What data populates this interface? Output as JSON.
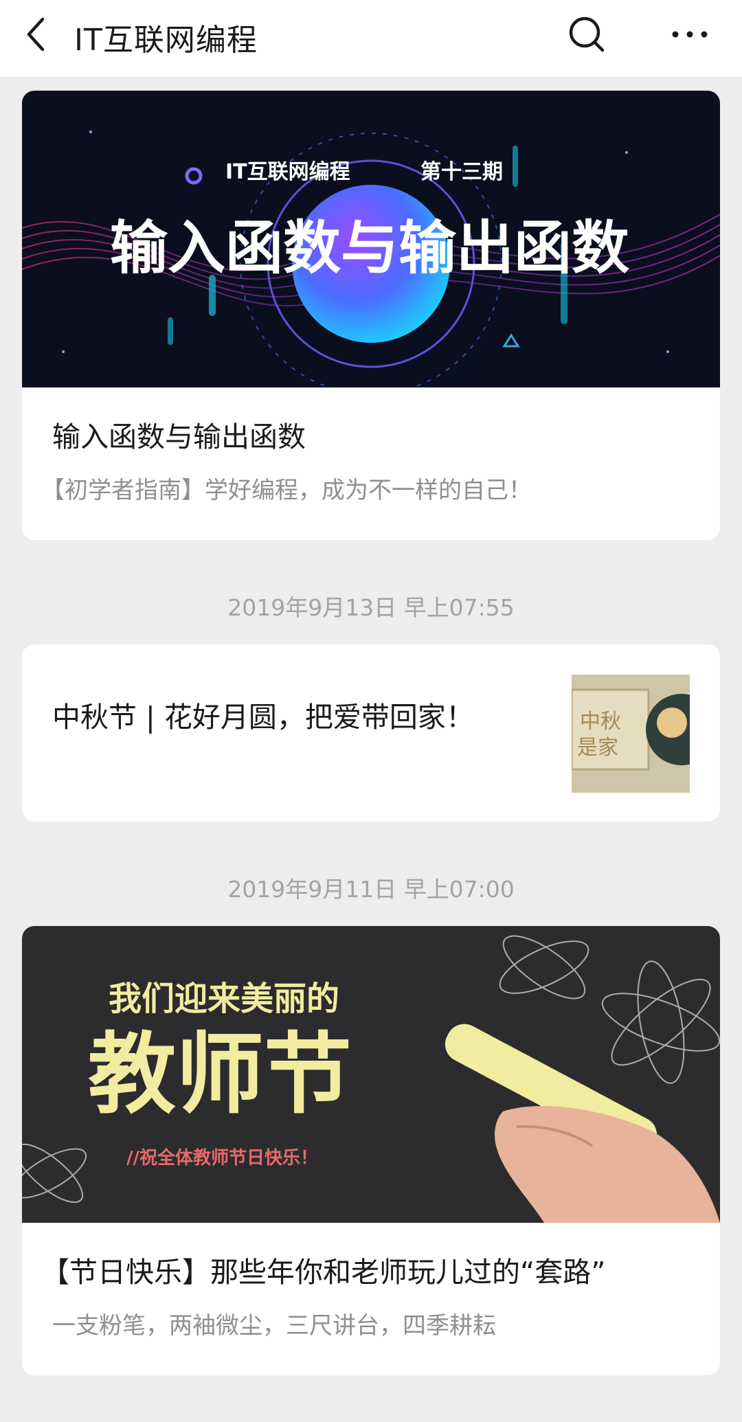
{
  "header": {
    "title": "IT互联网编程",
    "back_icon": "chevron-left-icon",
    "search_icon": "search-icon",
    "more_icon": "more-horizontal-icon"
  },
  "articles": [
    {
      "cover_line1_left": "IT互联网编程",
      "cover_line1_right": "第十三期",
      "cover_headline": "输入函数与输出函数",
      "title": "输入函数与输出函数",
      "digest": "【初学者指南】学好编程，成为不一样的自己！"
    },
    {
      "timestamp": "2019年9月13日 早上07:55",
      "title": "中秋节 | 花好月圆，把爱带回家！",
      "thumb_text_1": "中秋",
      "thumb_text_2": "是家"
    },
    {
      "timestamp": "2019年9月11日 早上07:00",
      "cover_line1": "我们迎来美丽的",
      "cover_headline": "教师节",
      "cover_subline": "//祝全体教师节日快乐！",
      "title": "【节日快乐】那些年你和老师玩儿过的“套路”",
      "digest": "一支粉笔，两袖微尘，三尺讲台，四季耕耘"
    }
  ],
  "colors": {
    "background": "#ededed",
    "card": "#ffffff",
    "cover1_bg": "#0b0e1e",
    "cover3_bg": "#2c2c2e",
    "chalk": "#f1eca0"
  }
}
